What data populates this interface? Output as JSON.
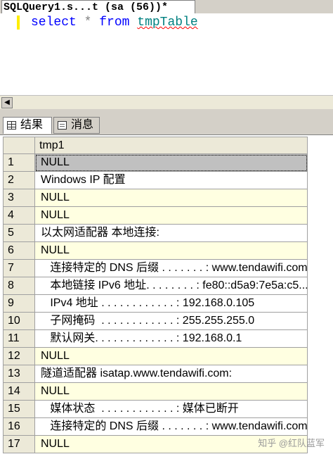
{
  "query_tab": {
    "title": "SQLQuery1.s...t (sa (56))*"
  },
  "editor": {
    "keyword_select": "select",
    "operator_star": "*",
    "keyword_from": "from",
    "table_name": "tmpTable"
  },
  "result_tabs": [
    {
      "label": "结果",
      "icon": "grid-icon",
      "active": true
    },
    {
      "label": "消息",
      "icon": "message-icon",
      "active": false
    }
  ],
  "grid": {
    "column_header": "tmp1",
    "rows": [
      {
        "num": "1",
        "value": "NULL"
      },
      {
        "num": "2",
        "value": "Windows IP 配置"
      },
      {
        "num": "3",
        "value": "NULL"
      },
      {
        "num": "4",
        "value": "NULL"
      },
      {
        "num": "5",
        "value": "以太网适配器 本地连接:"
      },
      {
        "num": "6",
        "value": "NULL"
      },
      {
        "num": "7",
        "value": "   连接特定的 DNS 后缀 . . . . . . . : www.tendawifi.com"
      },
      {
        "num": "8",
        "value": "   本地链接 IPv6 地址. . . . . . . . : fe80::d5a9:7e5a:c5..."
      },
      {
        "num": "9",
        "value": "   IPv4 地址 . . . . . . . . . . . . : 192.168.0.105"
      },
      {
        "num": "10",
        "value": "   子网掩码  . . . . . . . . . . . . : 255.255.255.0"
      },
      {
        "num": "11",
        "value": "   默认网关. . . . . . . . . . . . . : 192.168.0.1"
      },
      {
        "num": "12",
        "value": "NULL"
      },
      {
        "num": "13",
        "value": "隧道适配器 isatap.www.tendawifi.com:"
      },
      {
        "num": "14",
        "value": "NULL"
      },
      {
        "num": "15",
        "value": "   媒体状态  . . . . . . . . . . . . : 媒体已断开"
      },
      {
        "num": "16",
        "value": "   连接特定的 DNS 后缀 . . . . . . . : www.tendawifi.com"
      },
      {
        "num": "17",
        "value": "NULL"
      }
    ]
  },
  "watermark": "知乎 @红队蓝军",
  "colors": {
    "null_row_highlight": "#ffffe1",
    "selected_cell": "#c0c0c0",
    "keyword": "#0000ff",
    "identifier": "#008080"
  }
}
